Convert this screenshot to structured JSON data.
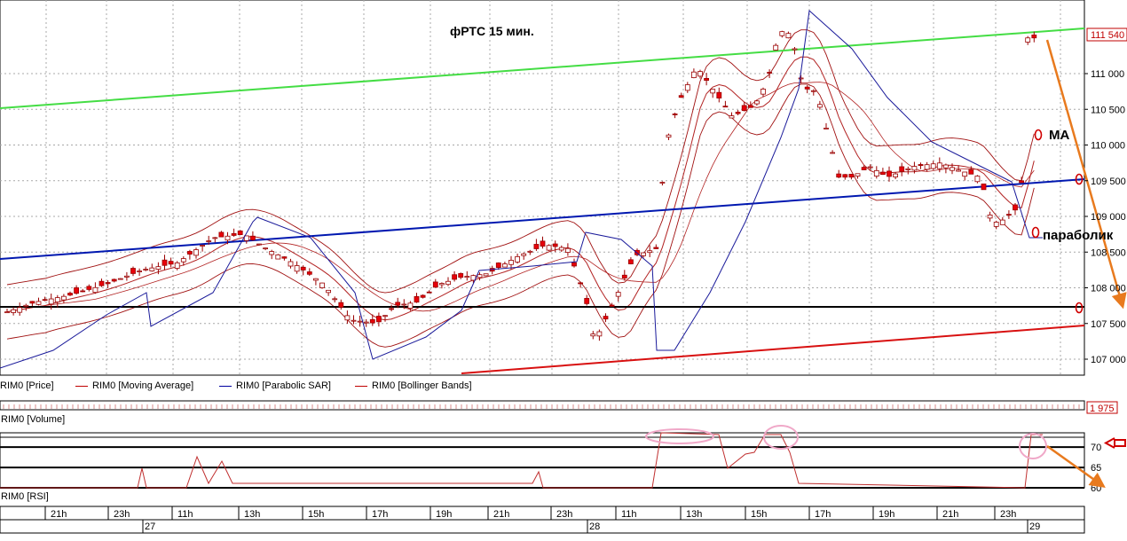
{
  "chart_data": {
    "type": "candlestick",
    "title": "фРТС   15 мин.",
    "price_axis": {
      "ticks": [
        107000,
        107500,
        108000,
        108500,
        109000,
        109500,
        110000,
        110500,
        111000
      ],
      "tick_labels": [
        "107 000",
        "107 500",
        "108 000",
        "108 500",
        "109 000",
        "109 500",
        "110 000",
        "110 500",
        "111 000"
      ],
      "ylim": [
        106800,
        111750
      ],
      "last_price_label": "111 540",
      "last_price": 111540
    },
    "time_axis": {
      "hour_labels": [
        "21h",
        "23h",
        "11h",
        "13h",
        "15h",
        "17h",
        "19h",
        "21h",
        "23h",
        "11h",
        "13h",
        "15h",
        "17h",
        "19h",
        "21h",
        "23h"
      ],
      "day_labels": [
        "27",
        "28",
        "29"
      ]
    },
    "legend": [
      {
        "name": "RIM0 [Price]",
        "color": "#000000"
      },
      {
        "name": "RIM0 [Moving Average]",
        "color": "#c00000"
      },
      {
        "name": "RIM0 [Parabolic SAR]",
        "color": "#0000a0"
      },
      {
        "name": "RIM0 [Bollinger Bands]",
        "color": "#c00000"
      }
    ],
    "annotations": {
      "ma_label": "MA",
      "parabolic_label": "параболик"
    },
    "trend_lines": [
      {
        "color": "#44dd44"
      },
      {
        "color": "#0018b0"
      },
      {
        "color": "#000000"
      },
      {
        "color": "#d81010"
      },
      {
        "color": "#e87a1e"
      }
    ],
    "volume_panel": {
      "title": "RIM0 [Volume]",
      "value_label": "1 975"
    },
    "rsi_panel": {
      "title": "RIM0 [RSI]",
      "levels": [
        70,
        65,
        60
      ],
      "level_labels": [
        "70",
        "65",
        "60"
      ]
    },
    "colors": {
      "candle": "#e8000a",
      "candle_border": "#9a0000",
      "ma": "#b22222",
      "sar": "#1a1a9a",
      "bands": "#a01010",
      "grid": "#a8a8a8",
      "highlight_ellipse": "#f0a8c8",
      "arrow": "#e87a1e"
    }
  }
}
